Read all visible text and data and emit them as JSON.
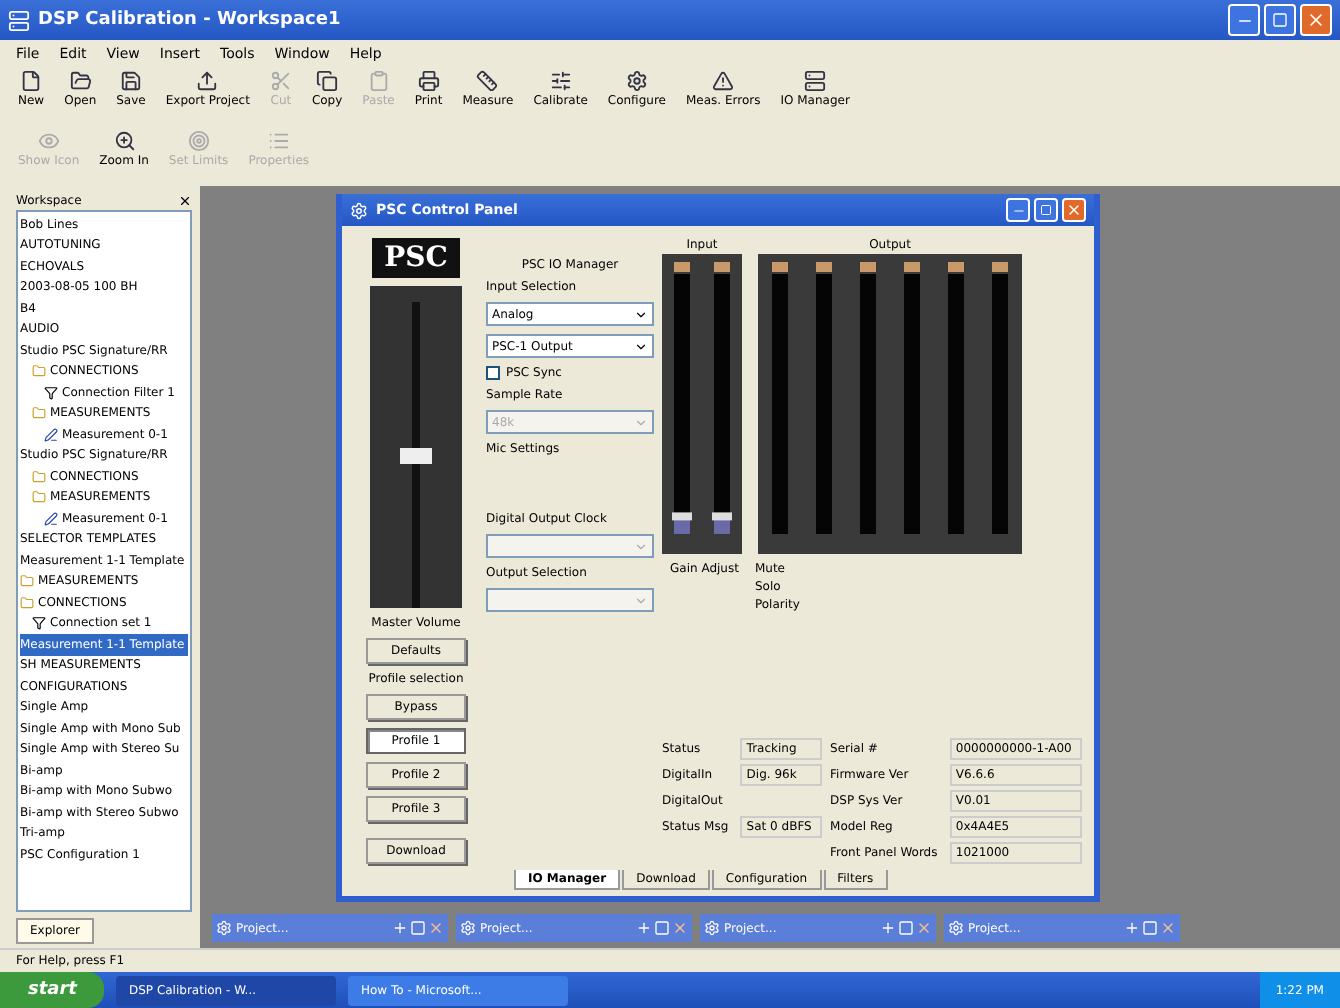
{
  "window": {
    "title": "DSP Calibration - Workspace1"
  },
  "menu": [
    "File",
    "Edit",
    "View",
    "Insert",
    "Tools",
    "Window",
    "Help"
  ],
  "toolbar": [
    {
      "label": "New",
      "disabled": false
    },
    {
      "label": "Open",
      "disabled": false
    },
    {
      "label": "Save",
      "disabled": false
    },
    {
      "label": "Export Project",
      "disabled": false
    },
    {
      "label": "Cut",
      "disabled": true
    },
    {
      "label": "Copy",
      "disabled": false
    },
    {
      "label": "Paste",
      "disabled": true
    },
    {
      "label": "Print",
      "disabled": false
    },
    {
      "label": "Measure",
      "disabled": false
    },
    {
      "label": "Calibrate",
      "disabled": false
    },
    {
      "label": "Configure",
      "disabled": false
    },
    {
      "label": "Meas. Errors",
      "disabled": false
    },
    {
      "label": "IO Manager",
      "disabled": false
    }
  ],
  "toolbar2": [
    {
      "label": "Show Icon",
      "disabled": true
    },
    {
      "label": "Zoom In",
      "disabled": false
    },
    {
      "label": "Set Limits",
      "disabled": true
    },
    {
      "label": "Properties",
      "disabled": true
    }
  ],
  "workspace": {
    "title": "Workspace",
    "tab": "Explorer",
    "items": [
      {
        "label": "Bob Lines",
        "kind": "text",
        "selected": false
      },
      {
        "label": "AUTOTUNING",
        "kind": "text",
        "selected": false
      },
      {
        "label": "ECHOVALS",
        "kind": "text",
        "selected": false
      },
      {
        "label": "2003-08-05 100 BH",
        "kind": "text",
        "selected": false
      },
      {
        "label": "B4",
        "kind": "text",
        "selected": false
      },
      {
        "label": "AUDIO",
        "kind": "text",
        "selected": false
      },
      {
        "label": "Studio PSC Signature/RR",
        "kind": "text",
        "selected": false,
        "children": [
          {
            "label": "CONNECTIONS",
            "kind": "folder",
            "selected": false,
            "children": [
              {
                "label": "Connection Filter 1",
                "kind": "filter",
                "selected": false
              }
            ]
          },
          {
            "label": "MEASUREMENTS",
            "kind": "folder",
            "selected": false,
            "children": [
              {
                "label": "Measurement 0-1",
                "kind": "measure",
                "selected": false
              }
            ]
          }
        ]
      },
      {
        "label": "Studio PSC Signature/RR",
        "kind": "text",
        "selected": false,
        "children": [
          {
            "label": "CONNECTIONS",
            "kind": "folder",
            "selected": false
          },
          {
            "label": "MEASUREMENTS",
            "kind": "folder",
            "selected": false,
            "children": [
              {
                "label": "Measurement 0-1",
                "kind": "measure",
                "selected": false
              }
            ]
          }
        ]
      },
      {
        "label": "SELECTOR TEMPLATES",
        "kind": "text",
        "selected": false
      },
      {
        "label": "Measurement 1-1 Template",
        "kind": "text",
        "selected": false
      },
      {
        "label": "MEASUREMENTS",
        "kind": "folder",
        "selected": false
      },
      {
        "label": "CONNECTIONS",
        "kind": "folder",
        "selected": false,
        "children": [
          {
            "label": "Connection set 1",
            "kind": "filter",
            "selected": false
          }
        ]
      },
      {
        "label": "Measurement 1-1 Template",
        "kind": "text",
        "selected": true
      },
      {
        "label": "SH MEASUREMENTS",
        "kind": "text",
        "selected": false
      },
      {
        "label": "CONFIGURATIONS",
        "kind": "text",
        "selected": false
      },
      {
        "label": "Single Amp",
        "kind": "text",
        "selected": false
      },
      {
        "label": "Single Amp with Mono Sub",
        "kind": "text",
        "selected": false
      },
      {
        "label": "Single Amp with Stereo Su",
        "kind": "text",
        "selected": false
      },
      {
        "label": "Bi-amp",
        "kind": "text",
        "selected": false
      },
      {
        "label": "Bi-amp with Mono Subwo",
        "kind": "text",
        "selected": false
      },
      {
        "label": "Bi-amp with Stereo Subwo",
        "kind": "text",
        "selected": false
      },
      {
        "label": "Tri-amp",
        "kind": "text",
        "selected": false
      },
      {
        "label": "PSC Configuration 1",
        "kind": "text",
        "selected": false
      }
    ]
  },
  "panel": {
    "title": "PSC Control Panel",
    "logo": "PSC",
    "master_label": "Master Volume",
    "defaults": "Defaults",
    "profile_label": "Profile selection",
    "profiles": [
      {
        "label": "Bypass",
        "selected": false
      },
      {
        "label": "Profile 1",
        "selected": true
      },
      {
        "label": "Profile 2",
        "selected": false
      },
      {
        "label": "Profile 3",
        "selected": false
      }
    ],
    "download": "Download",
    "io_manager": "PSC IO Manager",
    "input_selection": "Input Selection",
    "input_options": [
      "Analog",
      "PSC-1 Output"
    ],
    "sync": {
      "label": "PSC Sync",
      "checked": false
    },
    "sample_rate": "Sample Rate",
    "sample_value": "48k",
    "mic_settings": "Mic Settings",
    "digital_clock": "Digital Output Clock",
    "output_selection": "Output Selection",
    "input_title": "Input",
    "output_title": "Output",
    "inputs": [
      {
        "level": 0.06
      },
      {
        "level": 0.06
      }
    ],
    "gain_label": "Gain Adjust",
    "toggles": [
      "Mute",
      "Solo",
      "Polarity"
    ],
    "status": [
      {
        "label": "Status",
        "value": "Tracking"
      },
      {
        "label": "DigitalIn",
        "value": "Dig. 96k"
      },
      {
        "label": "DigitalOut"
      },
      {
        "label": "Status Msg",
        "value": "Sat 0 dBFS"
      }
    ],
    "info": [
      {
        "label": "Serial #",
        "value": "0000000000-1-A00"
      },
      {
        "label": "Firmware Ver",
        "value": "V6.6.6"
      },
      {
        "label": "DSP Sys Ver",
        "value": "V0.01"
      },
      {
        "label": "Model Reg",
        "value": "0x4A4E5"
      },
      {
        "label": "Front Panel Words",
        "value": "1021000"
      }
    ],
    "tabs": [
      {
        "label": "IO Manager",
        "selected": true
      },
      {
        "label": "Download",
        "selected": false
      },
      {
        "label": "Configuration",
        "selected": false
      },
      {
        "label": "Filters",
        "selected": false
      }
    ]
  },
  "minimized": [
    "Project...",
    "Project...",
    "Project...",
    "Project..."
  ],
  "status_bar": "For Help, press F1",
  "taskbar": {
    "start": "start",
    "tasks": [
      {
        "label": "DSP Calibration - W...",
        "selected": true
      },
      {
        "label": "How To - Microsoft...",
        "selected": false
      }
    ],
    "clock": "1:22 PM"
  }
}
